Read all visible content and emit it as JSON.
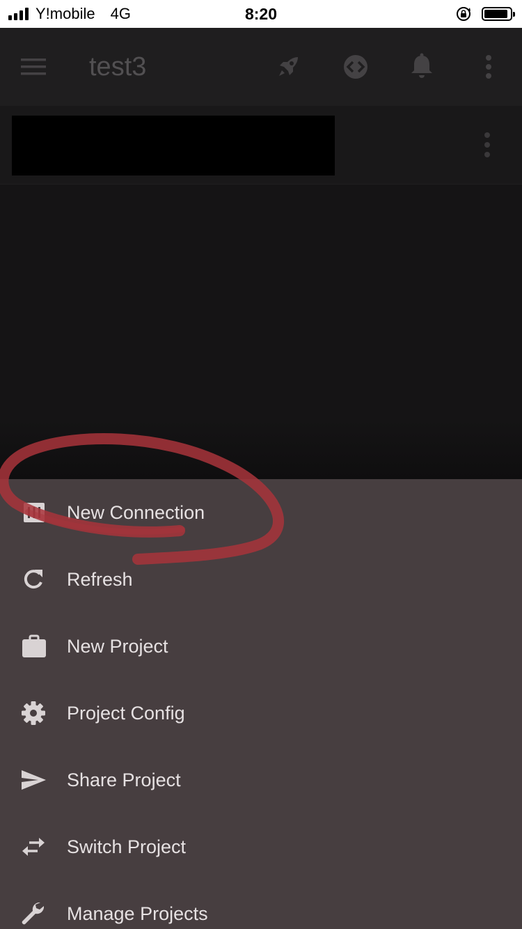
{
  "status_bar": {
    "carrier": "Y!mobile",
    "network": "4G",
    "time": "8:20"
  },
  "app_bar": {
    "title": "test3",
    "icons": [
      "menu-icon",
      "rocket-icon",
      "code-icon",
      "bell-icon",
      "more-vert-icon"
    ]
  },
  "sub_header": {
    "icons": [
      "more-vert-icon"
    ]
  },
  "sheet": {
    "items": [
      {
        "label": "New Connection",
        "icon": "connection-icon"
      },
      {
        "label": "Refresh",
        "icon": "refresh-icon"
      },
      {
        "label": "New Project",
        "icon": "briefcase-icon"
      },
      {
        "label": "Project Config",
        "icon": "gear-icon"
      },
      {
        "label": "Share Project",
        "icon": "send-icon"
      },
      {
        "label": "Switch Project",
        "icon": "swap-icon"
      },
      {
        "label": "Manage Projects",
        "icon": "wrench-icon"
      }
    ]
  },
  "colors": {
    "app_bar_bg": "#1f1e1f",
    "sheet_bg": "#473e40",
    "annotation": "#a8343b"
  }
}
